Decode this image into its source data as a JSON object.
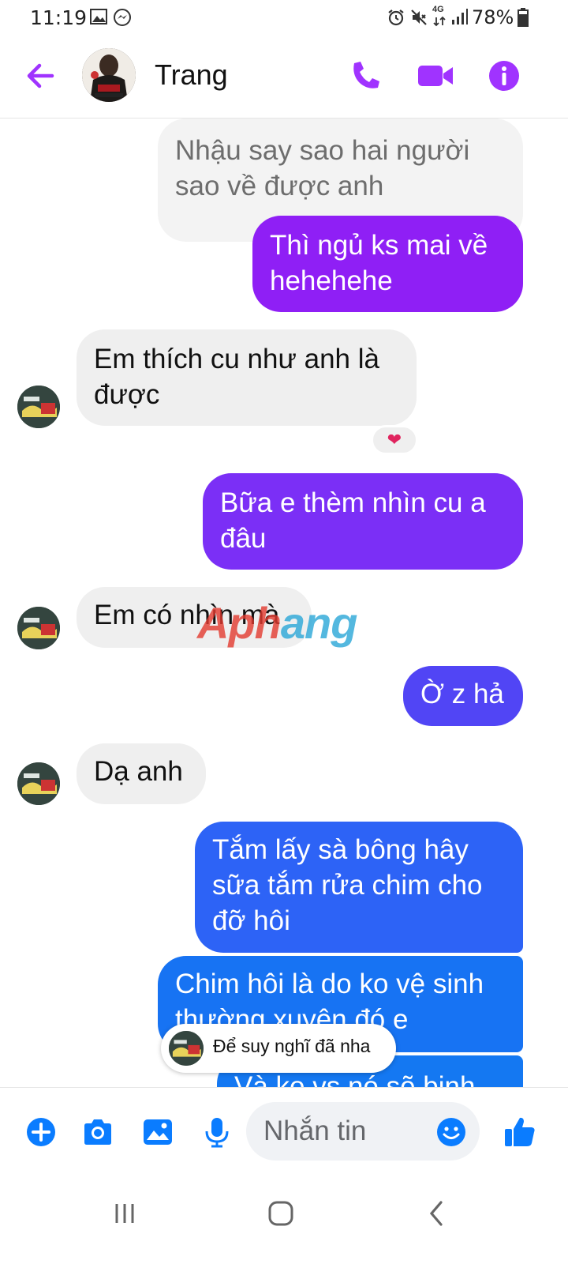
{
  "status_bar": {
    "time": "11:19",
    "battery_percent": "78%",
    "network_label": "4G"
  },
  "header": {
    "contact_name": "Trang",
    "back_icon": "arrow-left-icon",
    "call_icon": "phone-icon",
    "video_icon": "video-camera-icon",
    "info_icon": "info-icon",
    "accent_color": "#a033ff"
  },
  "messages": [
    {
      "sender": "contact",
      "text": "Nhậu say sao hai người sao về được anh"
    },
    {
      "sender": "me",
      "text": "Thì ngủ ks mai về hehehehe",
      "color": "#8f1ff5"
    },
    {
      "sender": "contact",
      "text": "Em thích cu như anh là được",
      "reaction": "❤"
    },
    {
      "sender": "me",
      "text": "Bữa e thèm nhìn cu a đâu",
      "color": "#7b2ff6"
    },
    {
      "sender": "contact",
      "text": "Em có nhìn mà"
    },
    {
      "sender": "me",
      "text": "Ờ z hả",
      "color": "#5145f5"
    },
    {
      "sender": "contact",
      "text": "Dạ anh"
    },
    {
      "sender": "me",
      "text": "Tắm lấy sà bông hây sữa tắm rửa chim cho đỡ hôi",
      "color": "#2d63f6"
    },
    {
      "sender": "me",
      "text": "Chim hôi là do ko vệ sinh thường xuyên đó e",
      "color": "#1773f3"
    },
    {
      "sender": "me",
      "text": "Và ko vs nó sẽ bịnh",
      "color": "#1478f2"
    }
  ],
  "watermark": {
    "part1": "Aph",
    "part2": "ang"
  },
  "typing_preview": {
    "text": "Để suy nghĩ đã nha"
  },
  "composer": {
    "placeholder": "Nhắn tin",
    "icons": [
      "plus-icon",
      "camera-icon",
      "gallery-icon",
      "microphone-icon",
      "emoji-icon",
      "thumbs-up-icon"
    ],
    "accent_color": "#0a7cff"
  },
  "nav": {
    "icons": [
      "recent-apps-icon",
      "home-icon",
      "back-icon"
    ]
  }
}
